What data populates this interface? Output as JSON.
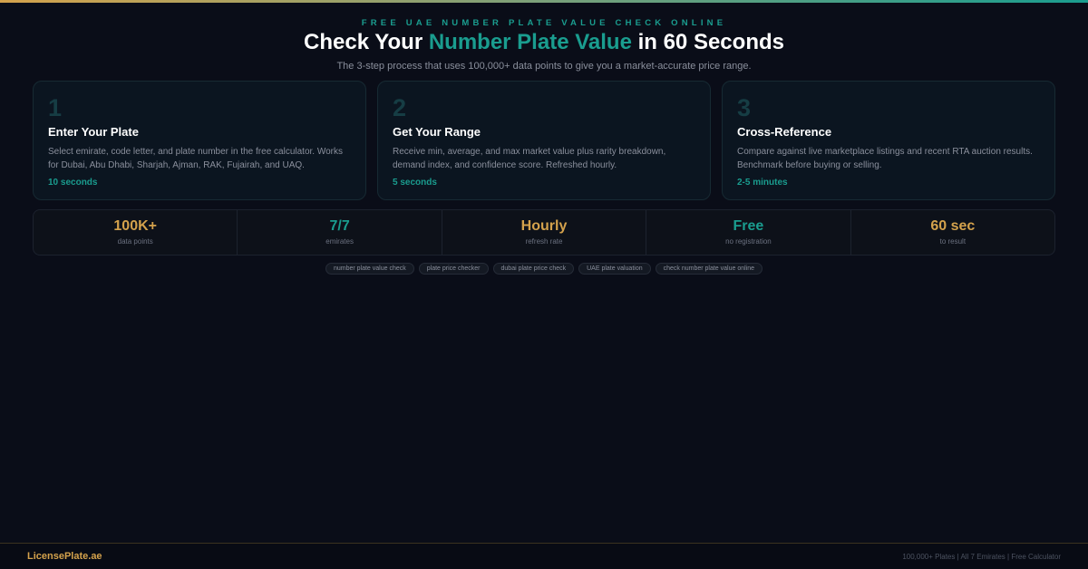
{
  "header": {
    "eyebrow": "FREE UAE NUMBER PLATE VALUE CHECK ONLINE",
    "title_pre": "Check Your ",
    "title_accent": "Number Plate Value",
    "title_post": " in 60 Seconds",
    "subtitle": "The 3-step process that uses 100,000+ data points to give you a market-accurate price range."
  },
  "steps": [
    {
      "num": "1",
      "title": "Enter Your Plate",
      "desc": "Select emirate, code letter, and plate number in the free calculator. Works for Dubai, Abu Dhabi, Sharjah, Ajman, RAK, Fujairah, and UAQ.",
      "time": "10 seconds"
    },
    {
      "num": "2",
      "title": "Get Your Range",
      "desc": "Receive min, average, and max market value plus rarity breakdown, demand index, and confidence score. Refreshed hourly.",
      "time": "5 seconds"
    },
    {
      "num": "3",
      "title": "Cross-Reference",
      "desc": "Compare against live marketplace listings and recent RTA auction results. Benchmark before buying or selling.",
      "time": "2-5 minutes"
    }
  ],
  "stats": [
    {
      "value": "100K+",
      "label": "data points"
    },
    {
      "value": "7/7",
      "label": "emirates"
    },
    {
      "value": "Hourly",
      "label": "refresh rate"
    },
    {
      "value": "Free",
      "label": "no registration"
    },
    {
      "value": "60 sec",
      "label": "to result"
    }
  ],
  "tags": [
    "number plate value check",
    "plate price checker",
    "dubai plate price check",
    "UAE plate valuation",
    "check number plate value online"
  ],
  "footer": {
    "brand": "LicensePlate.ae",
    "meta": "100,000+ Plates | All 7 Emirates | Free Calculator"
  },
  "colors": {
    "accent_teal": "#1a9d8f",
    "accent_gold": "#d4a24c",
    "background": "#0a0d18"
  }
}
